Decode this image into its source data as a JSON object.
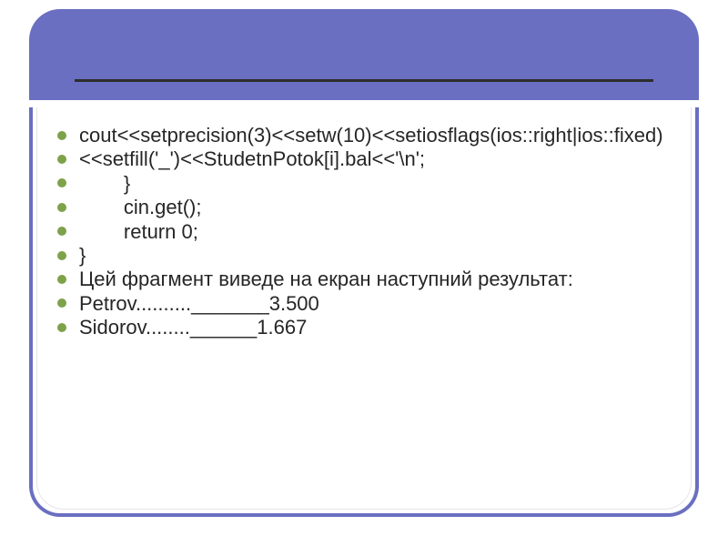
{
  "bullets": [
    "cout<<setprecision(3)<<setw(10)<<setiosflags(ios::right|ios::fixed)",
    "<<setfill('_')<<StudetnPotok[i].bal<<'\\n';",
    "        }",
    "        cin.get();",
    "        return 0;",
    "}",
    "Цей фрагмент виведе на екран наступний результат:",
    "Petrov.........._______3.500",
    "Sidorov........______1.667"
  ]
}
